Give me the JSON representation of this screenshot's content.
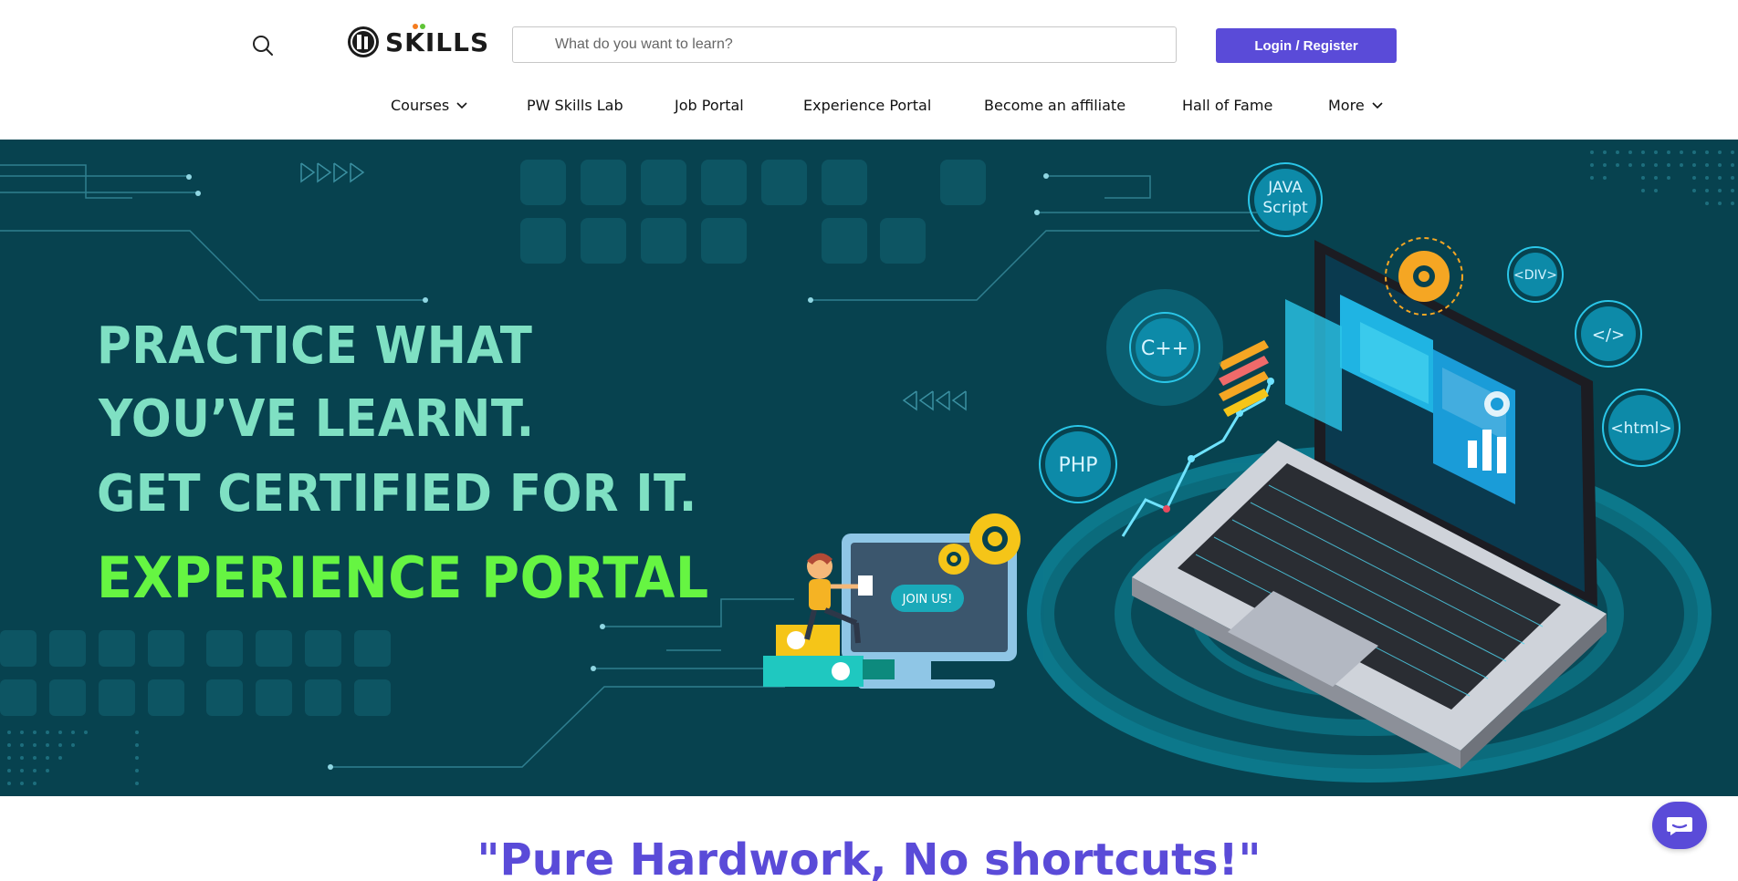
{
  "header": {
    "logo_text": "SKILLS",
    "search_placeholder": "What do you want to learn?",
    "login_label": "Login / Register"
  },
  "nav": {
    "items": [
      {
        "label": "Courses",
        "has_dropdown": true
      },
      {
        "label": "PW Skills Lab"
      },
      {
        "label": "Job Portal"
      },
      {
        "label": "Experience Portal"
      },
      {
        "label": "Become an affiliate"
      },
      {
        "label": "Hall of Fame"
      },
      {
        "label": "More",
        "has_dropdown": true
      }
    ]
  },
  "hero": {
    "line1": "PRACTICE WHAT",
    "line2": "YOU’VE LEARNT.",
    "line3": "GET CERTIFIED FOR IT.",
    "line4": "EXPERIENCE PORTAL",
    "join_label": "JOIN US!",
    "badges": [
      "JAVA",
      "Script",
      "C++",
      "PHP",
      "<DIV>",
      "</>",
      "<html>"
    ]
  },
  "quote": "\"Pure Hardwork, No shortcuts!\"",
  "colors": {
    "accent": "#5a4bd8",
    "hero_bg": "#07424f",
    "headline": "#7fe0c3",
    "headline_green": "#66f542"
  },
  "icons": [
    "search-icon",
    "chevron-down-icon",
    "chat-icon"
  ]
}
